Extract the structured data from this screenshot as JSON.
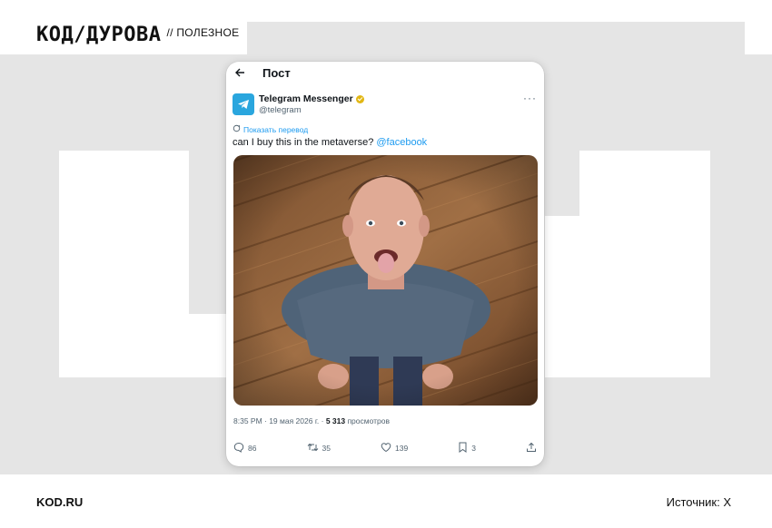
{
  "brand": {
    "logo": "КОД/ДУРОВА",
    "section": "// ПОЛЕЗНОЕ"
  },
  "footer": {
    "site": "KOD.RU",
    "source": "Источник: X"
  },
  "post": {
    "header_title": "Пост",
    "author": {
      "name": "Telegram Messenger",
      "handle": "@telegram"
    },
    "translate_label": "Показать перевод",
    "text_before": "can I buy this in the metaverse? ",
    "mention": "@facebook",
    "time": "8:35 PM · 19 мая 2026 г. · ",
    "views_count": "5 313",
    "views_label": " просмотров",
    "actions": {
      "replies": "86",
      "reposts": "35",
      "likes": "139",
      "bookmarks": "3"
    }
  },
  "colors": {
    "accent": "#1d9bf0",
    "telegram": "#2aa6de",
    "verified": "#e2b714"
  },
  "icons": [
    "back-arrow-icon",
    "telegram-logo-icon",
    "verified-badge-icon",
    "more-icon",
    "translate-icon",
    "reply-icon",
    "repost-icon",
    "like-icon",
    "bookmark-icon",
    "share-icon"
  ]
}
